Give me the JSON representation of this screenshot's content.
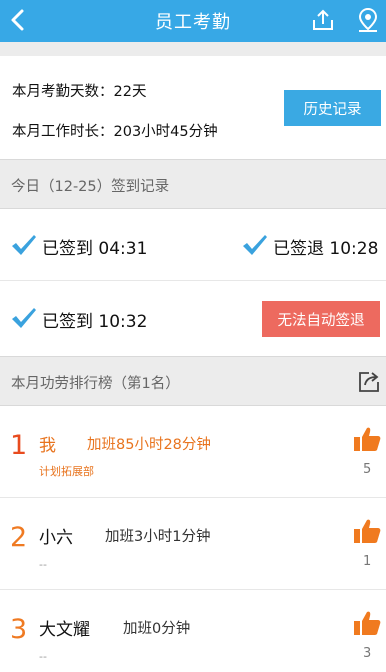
{
  "header": {
    "title": "员工考勤",
    "back_icon": "chevron-left-icon",
    "share_icon": "upload-icon",
    "location_icon": "location-icon",
    "bg_color": "#37a8e6"
  },
  "summary": {
    "days_text": "本月考勤天数：22天",
    "hours_text": "本月工作时长：203小时45分钟",
    "history_button": "历史记录"
  },
  "today": {
    "section_title": "今日（12-25）签到记录",
    "checkin_1": "已签到 04:31",
    "checkout_1": "已签退 10:28",
    "checkin_2": "已签到 10:32",
    "auto_checkout_button": "无法自动签退"
  },
  "ranking": {
    "section_title": "本月功劳排行榜（第1名）",
    "items": [
      {
        "rank": "1",
        "name": "我",
        "overtime": "加班85小时28分钟",
        "dept": "计划拓展部",
        "likes": "5"
      },
      {
        "rank": "2",
        "name": "小六",
        "overtime": "加班3小时1分钟",
        "dept": "--",
        "likes": "1"
      },
      {
        "rank": "3",
        "name": "大文耀",
        "overtime": "加班0分钟",
        "dept": "--",
        "likes": "3"
      }
    ]
  },
  "colors": {
    "accent": "#37a8e6",
    "danger": "#ed6a5f",
    "orange": "#ef7a22"
  }
}
